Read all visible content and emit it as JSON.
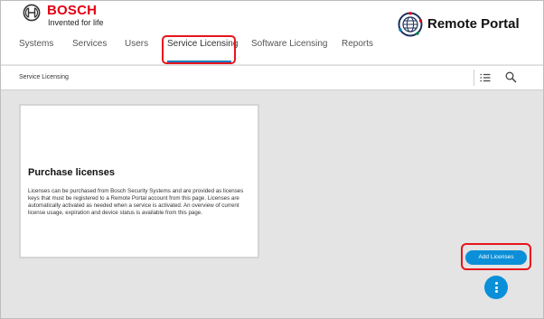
{
  "brand": {
    "name": "BOSCH",
    "tagline": "Invented for life",
    "logo_icon": "bosch-armature-icon",
    "color": "#e20015"
  },
  "app": {
    "title": "Remote Portal",
    "icon": "globe-icon"
  },
  "nav": {
    "items": [
      {
        "label": "Systems"
      },
      {
        "label": "Services"
      },
      {
        "label": "Users"
      },
      {
        "label": "Service Licensing",
        "active": true
      },
      {
        "label": "Software Licensing"
      },
      {
        "label": "Reports"
      }
    ],
    "accent": "#007bc0"
  },
  "breadcrumb": {
    "label": "Service Licensing",
    "icons": [
      "list-icon",
      "search-icon"
    ]
  },
  "card": {
    "title": "Purchase licenses",
    "text": "Licenses can be purchased from Bosch Security Systems and are provided as licenses keys that must be registered to a Remote Portal account from this page. Licenses are automatically activated as needed when a service is activated. An overview of current license usage, expiration and device status is available from this page."
  },
  "actions": {
    "add_label": "Add Licenses",
    "button_color": "#0a8fd8",
    "more_icon": "more-vertical-icon"
  },
  "highlight_color": "#e8141c"
}
